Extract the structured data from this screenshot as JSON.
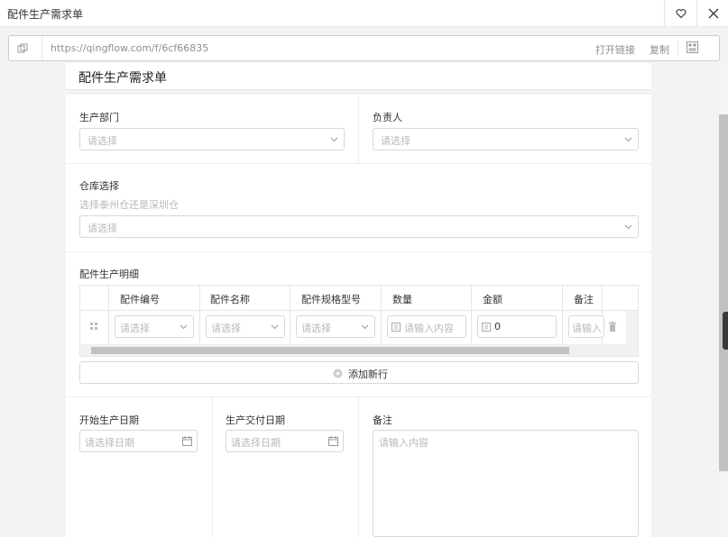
{
  "window": {
    "title": "配件生产需求单"
  },
  "urlbar": {
    "url": "https://qingflow.com/f/6cf66835",
    "open_link_label": "打开链接",
    "copy_label": "复制"
  },
  "form": {
    "title": "配件生产需求单",
    "fields": {
      "dept_label": "生产部门",
      "dept_placeholder": "请选择",
      "owner_label": "负责人",
      "owner_placeholder": "请选择",
      "warehouse_label": "仓库选择",
      "warehouse_hint": "选择泰州仓还是深圳仓",
      "warehouse_placeholder": "请选择"
    },
    "detail": {
      "label": "配件生产明细",
      "columns": [
        "配件编号",
        "配件名称",
        "配件规格型号",
        "数量",
        "金额",
        "备注"
      ],
      "row": {
        "part_no_placeholder": "请选择",
        "part_name_placeholder": "请选择",
        "spec_placeholder": "请选择",
        "qty_placeholder": "请输入内容",
        "amount_value": "0",
        "remark_placeholder": "请输入"
      },
      "add_row_label": "添加新行"
    },
    "bottom": {
      "start_label": "开始生产日期",
      "start_placeholder": "请选择日期",
      "delivery_label": "生产交付日期",
      "delivery_placeholder": "请选择日期",
      "remark_label": "备注",
      "remark_placeholder": "请输入内容"
    }
  },
  "colors": {
    "border": "#d5d8dd",
    "placeholder": "#b5b9c0",
    "background": "#f2f3f5"
  }
}
